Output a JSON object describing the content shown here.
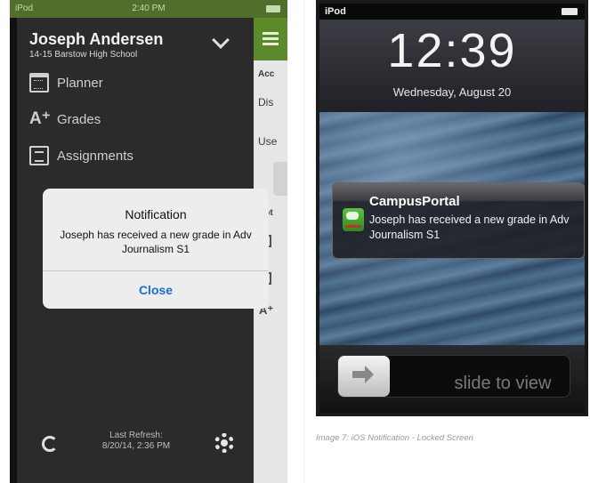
{
  "left_phone": {
    "status": {
      "carrier": "iPod",
      "time": "2:40 PM"
    },
    "user": {
      "name": "Joseph Andersen",
      "school": "14-15 Barstow High School"
    },
    "menu": [
      {
        "label": "Planner",
        "icon": "calendar-icon"
      },
      {
        "label": "Grades",
        "icon": "grades-icon"
      },
      {
        "label": "Assignments",
        "icon": "list-icon"
      }
    ],
    "footer": {
      "refresh_line1": "Last Refresh:",
      "refresh_line2": "8/20/14, 2:36 PM"
    },
    "peek": {
      "acc": "Acc",
      "dis": "Dis",
      "use": "Use",
      "not": "Not"
    },
    "dialog": {
      "title": "Notification",
      "message": "Joseph has received a new grade in Adv Journalism S1",
      "close_label": "Close"
    }
  },
  "right_phone": {
    "status": {
      "carrier": "iPod"
    },
    "time": "12:39",
    "date": "Wednesday, August 20",
    "notification": {
      "app_name": "CampusPortal",
      "message": "Joseph has received a new grade in Adv Journalism S1"
    },
    "slider_label": "slide to view"
  },
  "caption": "Image 7: iOS Notification - Locked Screen",
  "colors": {
    "accent_green": "#5a8a2a",
    "menu_bg": "#2b2b2b",
    "link_blue": "#1a6fd6"
  }
}
